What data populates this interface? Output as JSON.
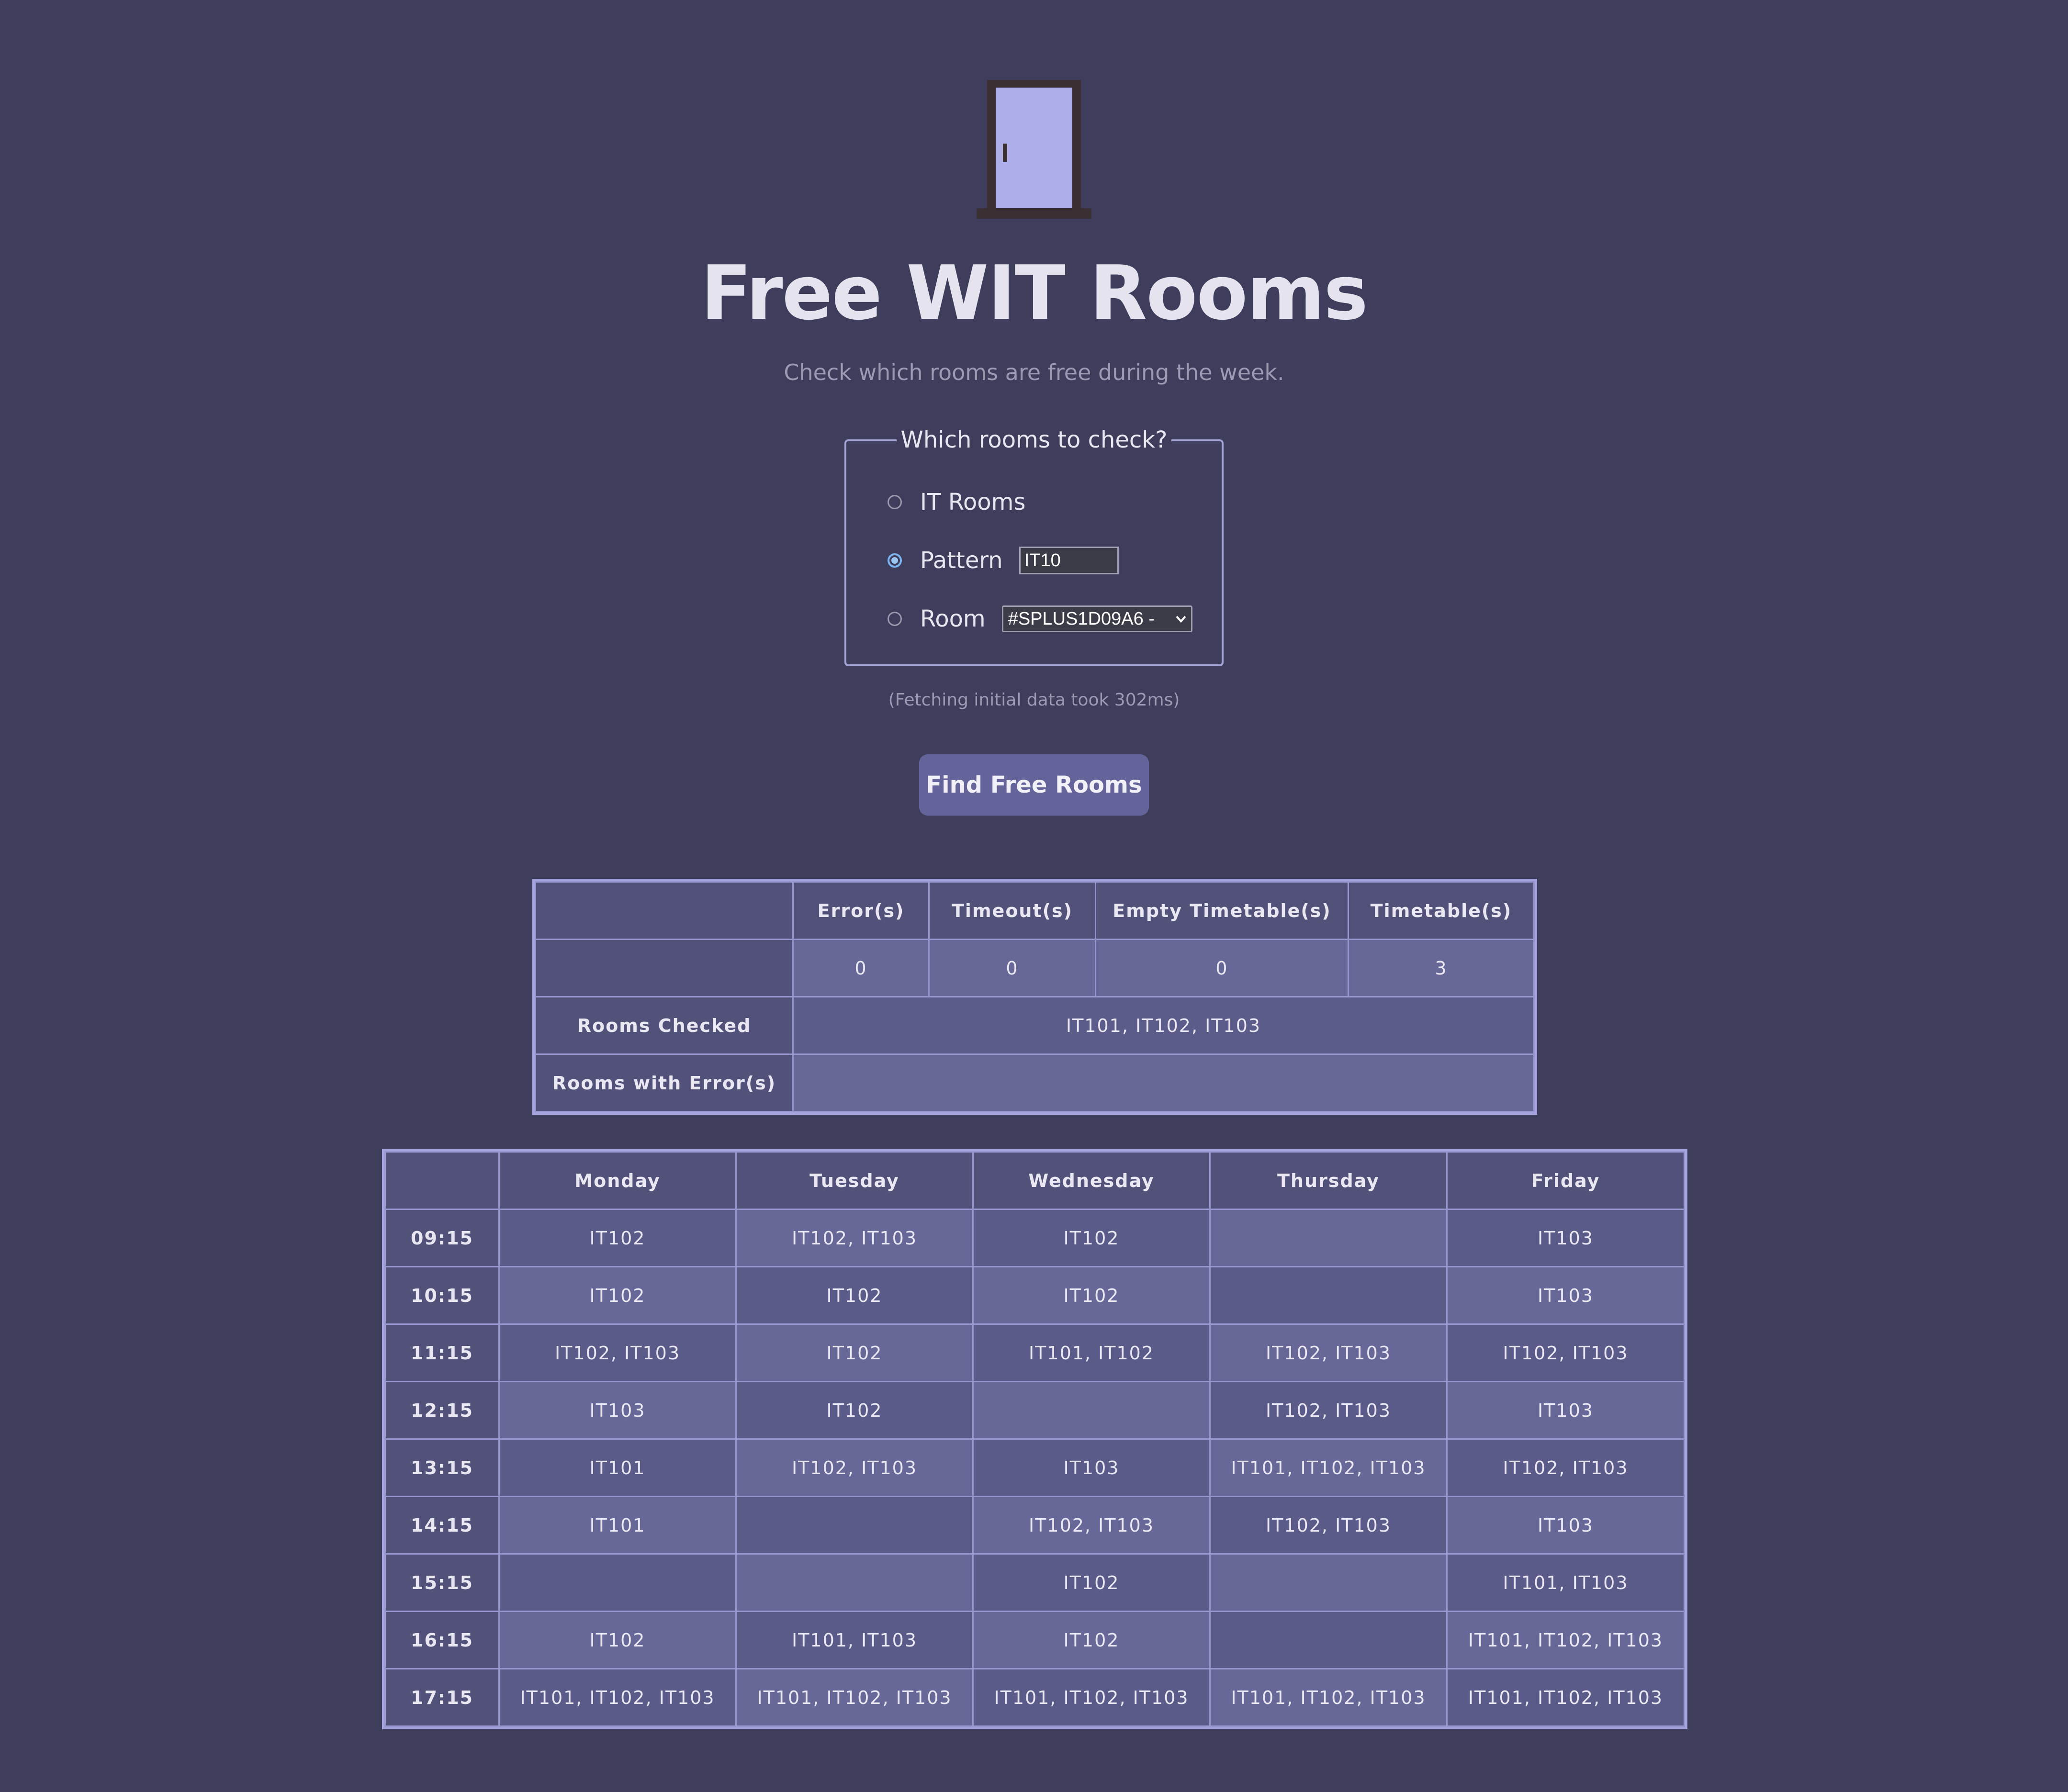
{
  "header": {
    "icon": "door-icon",
    "title": "Free WIT Rooms",
    "subtitle": "Check which rooms are free during the week."
  },
  "form": {
    "legend": "Which rooms to check?",
    "options": {
      "it_rooms": {
        "label": "IT Rooms",
        "checked": false
      },
      "pattern": {
        "label": "Pattern",
        "checked": true,
        "value": "IT10"
      },
      "room": {
        "label": "Room",
        "checked": false,
        "selected": "#SPLUS1D09A6 -"
      }
    }
  },
  "fetch_note": "(Fetching initial data took 302ms)",
  "find_button": "Find Free Rooms",
  "summary": {
    "headers": [
      "Error(s)",
      "Timeout(s)",
      "Empty Timetable(s)",
      "Timetable(s)"
    ],
    "counts": [
      "0",
      "0",
      "0",
      "3"
    ],
    "rooms_checked_label": "Rooms Checked",
    "rooms_checked": "IT101, IT102, IT103",
    "rooms_error_label": "Rooms with Error(s)",
    "rooms_error": ""
  },
  "timetable": {
    "days": [
      "Monday",
      "Tuesday",
      "Wednesday",
      "Thursday",
      "Friday"
    ],
    "rows": [
      {
        "time": "09:15",
        "cells": [
          "IT102",
          "IT102, IT103",
          "IT102",
          "",
          "IT103"
        ]
      },
      {
        "time": "10:15",
        "cells": [
          "IT102",
          "IT102",
          "IT102",
          "",
          "IT103"
        ]
      },
      {
        "time": "11:15",
        "cells": [
          "IT102, IT103",
          "IT102",
          "IT101, IT102",
          "IT102, IT103",
          "IT102, IT103"
        ]
      },
      {
        "time": "12:15",
        "cells": [
          "IT103",
          "IT102",
          "",
          "IT102, IT103",
          "IT103"
        ]
      },
      {
        "time": "13:15",
        "cells": [
          "IT101",
          "IT102, IT103",
          "IT103",
          "IT101, IT102, IT103",
          "IT102, IT103"
        ]
      },
      {
        "time": "14:15",
        "cells": [
          "IT101",
          "",
          "IT102, IT103",
          "IT102, IT103",
          "IT103"
        ]
      },
      {
        "time": "15:15",
        "cells": [
          "",
          "",
          "IT102",
          "",
          "IT101, IT103"
        ]
      },
      {
        "time": "16:15",
        "cells": [
          "IT102",
          "IT101, IT103",
          "IT102",
          "",
          "IT101, IT102, IT103"
        ]
      },
      {
        "time": "17:15",
        "cells": [
          "IT101, IT102, IT103",
          "IT101, IT102, IT103",
          "IT101, IT102, IT103",
          "IT101, IT102, IT103",
          "IT101, IT102, IT103"
        ]
      }
    ]
  }
}
